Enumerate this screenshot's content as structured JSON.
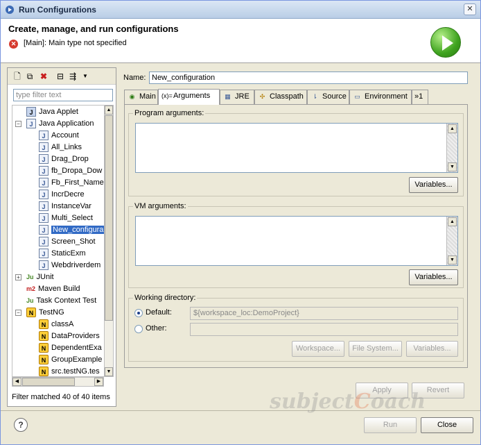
{
  "window": {
    "title": "Run Configurations"
  },
  "header": {
    "heading": "Create, manage, and run configurations",
    "error_message": "[Main]: Main type not specified"
  },
  "left": {
    "filter_placeholder": "type filter text",
    "tree": [
      {
        "label": "Java Applet",
        "icon": "java-applet-icon",
        "level": 1
      },
      {
        "label": "Java Application",
        "icon": "java-application-icon",
        "level": 1,
        "expanded": true
      },
      {
        "label": "Account",
        "icon": "java-file-icon",
        "level": 2
      },
      {
        "label": "All_Links",
        "icon": "java-file-icon",
        "level": 2
      },
      {
        "label": "Drag_Drop",
        "icon": "java-file-icon",
        "level": 2
      },
      {
        "label": "fb_Dropa_Dow",
        "icon": "java-file-icon",
        "level": 2
      },
      {
        "label": "Fb_First_Name",
        "icon": "java-file-icon",
        "level": 2
      },
      {
        "label": "IncrDecre",
        "icon": "java-file-icon",
        "level": 2
      },
      {
        "label": "InstanceVar",
        "icon": "java-file-icon",
        "level": 2
      },
      {
        "label": "Multi_Select",
        "icon": "java-file-icon",
        "level": 2
      },
      {
        "label": "New_configura",
        "icon": "java-file-icon",
        "level": 2,
        "selected": true
      },
      {
        "label": "Screen_Shot",
        "icon": "java-file-icon",
        "level": 2
      },
      {
        "label": "StaticExm",
        "icon": "java-file-icon",
        "level": 2
      },
      {
        "label": "Webdriverdem",
        "icon": "java-file-icon",
        "level": 2
      },
      {
        "label": "JUnit",
        "icon": "junit-icon",
        "level": 1,
        "collapsed": true
      },
      {
        "label": "Maven Build",
        "icon": "maven-icon",
        "level": 1
      },
      {
        "label": "Task Context Test",
        "icon": "junit-icon",
        "level": 1
      },
      {
        "label": "TestNG",
        "icon": "testng-icon",
        "level": 1,
        "expanded": true
      },
      {
        "label": "classA",
        "icon": "testng-icon",
        "level": 2
      },
      {
        "label": "DataProviders",
        "icon": "testng-icon",
        "level": 2
      },
      {
        "label": "DependentExa",
        "icon": "testng-icon",
        "level": 2
      },
      {
        "label": "GroupExample",
        "icon": "testng-icon",
        "level": 2
      },
      {
        "label": "src.testNG.tes",
        "icon": "testng-icon",
        "level": 2
      }
    ],
    "status": "Filter matched 40 of 40 items"
  },
  "config": {
    "name_label": "Name:",
    "name_value": "New_configuration",
    "tabs": [
      {
        "label": "Main",
        "icon": "main-tab-icon"
      },
      {
        "label": "Arguments",
        "icon": "arguments-tab-icon",
        "active": true
      },
      {
        "label": "JRE",
        "icon": "jre-tab-icon"
      },
      {
        "label": "Classpath",
        "icon": "classpath-tab-icon"
      },
      {
        "label": "Source",
        "icon": "source-tab-icon"
      },
      {
        "label": "Environment",
        "icon": "environment-tab-icon"
      },
      {
        "label": "»1",
        "icon": ""
      }
    ],
    "program_args_label": "Program arguments:",
    "vm_args_label": "VM arguments:",
    "variables_label": "Variables...",
    "working_dir_label": "Working directory:",
    "default_label": "Default:",
    "default_value": "${workspace_loc:DemoProject}",
    "other_label": "Other:",
    "workspace_label": "Workspace...",
    "filesystem_label": "File System...",
    "variables_disabled_label": "Variables..."
  },
  "actions": {
    "apply": "Apply",
    "revert": "Revert",
    "run": "Run",
    "close": "Close",
    "help": "?"
  },
  "watermark": {
    "part1": "subject",
    "part2": "C",
    "part3": "oach"
  }
}
